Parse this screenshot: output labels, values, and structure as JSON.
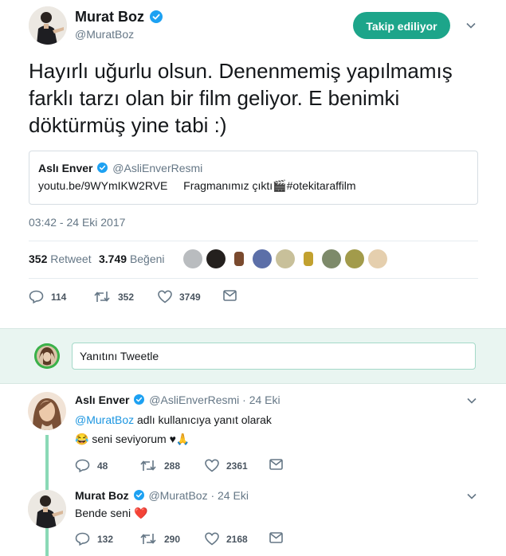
{
  "tweet": {
    "author_name": "Murat Boz",
    "author_handle": "@MuratBoz",
    "follow_button": "Takip ediliyor",
    "text": "Hayırlı uğurlu olsun. Denenmemiş yapılmamış farklı tarzı olan bir film geliyor. E benimki döktürmüş yine tabi :)",
    "quoted": {
      "name": "Aslı Enver",
      "handle": "@AsliEnverResmi",
      "link": "youtu.be/9WYmIKW2RVE",
      "text": "Fragmanımız çıktı",
      "emoji": "🎬",
      "hashtag": "#otekitaraffilm"
    },
    "timestamp": "03:42 - 24 Eki 2017",
    "stats": {
      "retweets_count": "352",
      "retweets_label": "Retweet",
      "likes_count": "3.749",
      "likes_label": "Beğeni"
    },
    "actions": {
      "replies": "114",
      "retweets": "352",
      "likes": "3749"
    }
  },
  "reply_box": {
    "placeholder": "Yanıtını Tweetle"
  },
  "replies": [
    {
      "name": "Aslı Enver",
      "handle": "@AsliEnverResmi",
      "date": "· 24 Eki",
      "replying_mention": "@MuratBoz",
      "replying_text": "adlı kullanıcıya yanıt olarak",
      "emoji_prefix": "😂",
      "text": "seni seviyorum ♥🙏",
      "actions": {
        "replies": "48",
        "retweets": "288",
        "likes": "2361"
      }
    },
    {
      "name": "Murat Boz",
      "handle": "@MuratBoz",
      "date": "· 24 Eki",
      "text": "Bende seni",
      "emoji_suffix": "❤️",
      "actions": {
        "replies": "132",
        "retweets": "290",
        "likes": "2168"
      }
    }
  ],
  "colors": {
    "accent": "#1da58a",
    "link": "#1b95e0",
    "verified": "#1da1f2",
    "thread": "#8ad9b6"
  },
  "icons": [
    "verified-icon",
    "chevron-down-icon",
    "reply-icon",
    "retweet-icon",
    "like-icon",
    "dm-icon"
  ]
}
